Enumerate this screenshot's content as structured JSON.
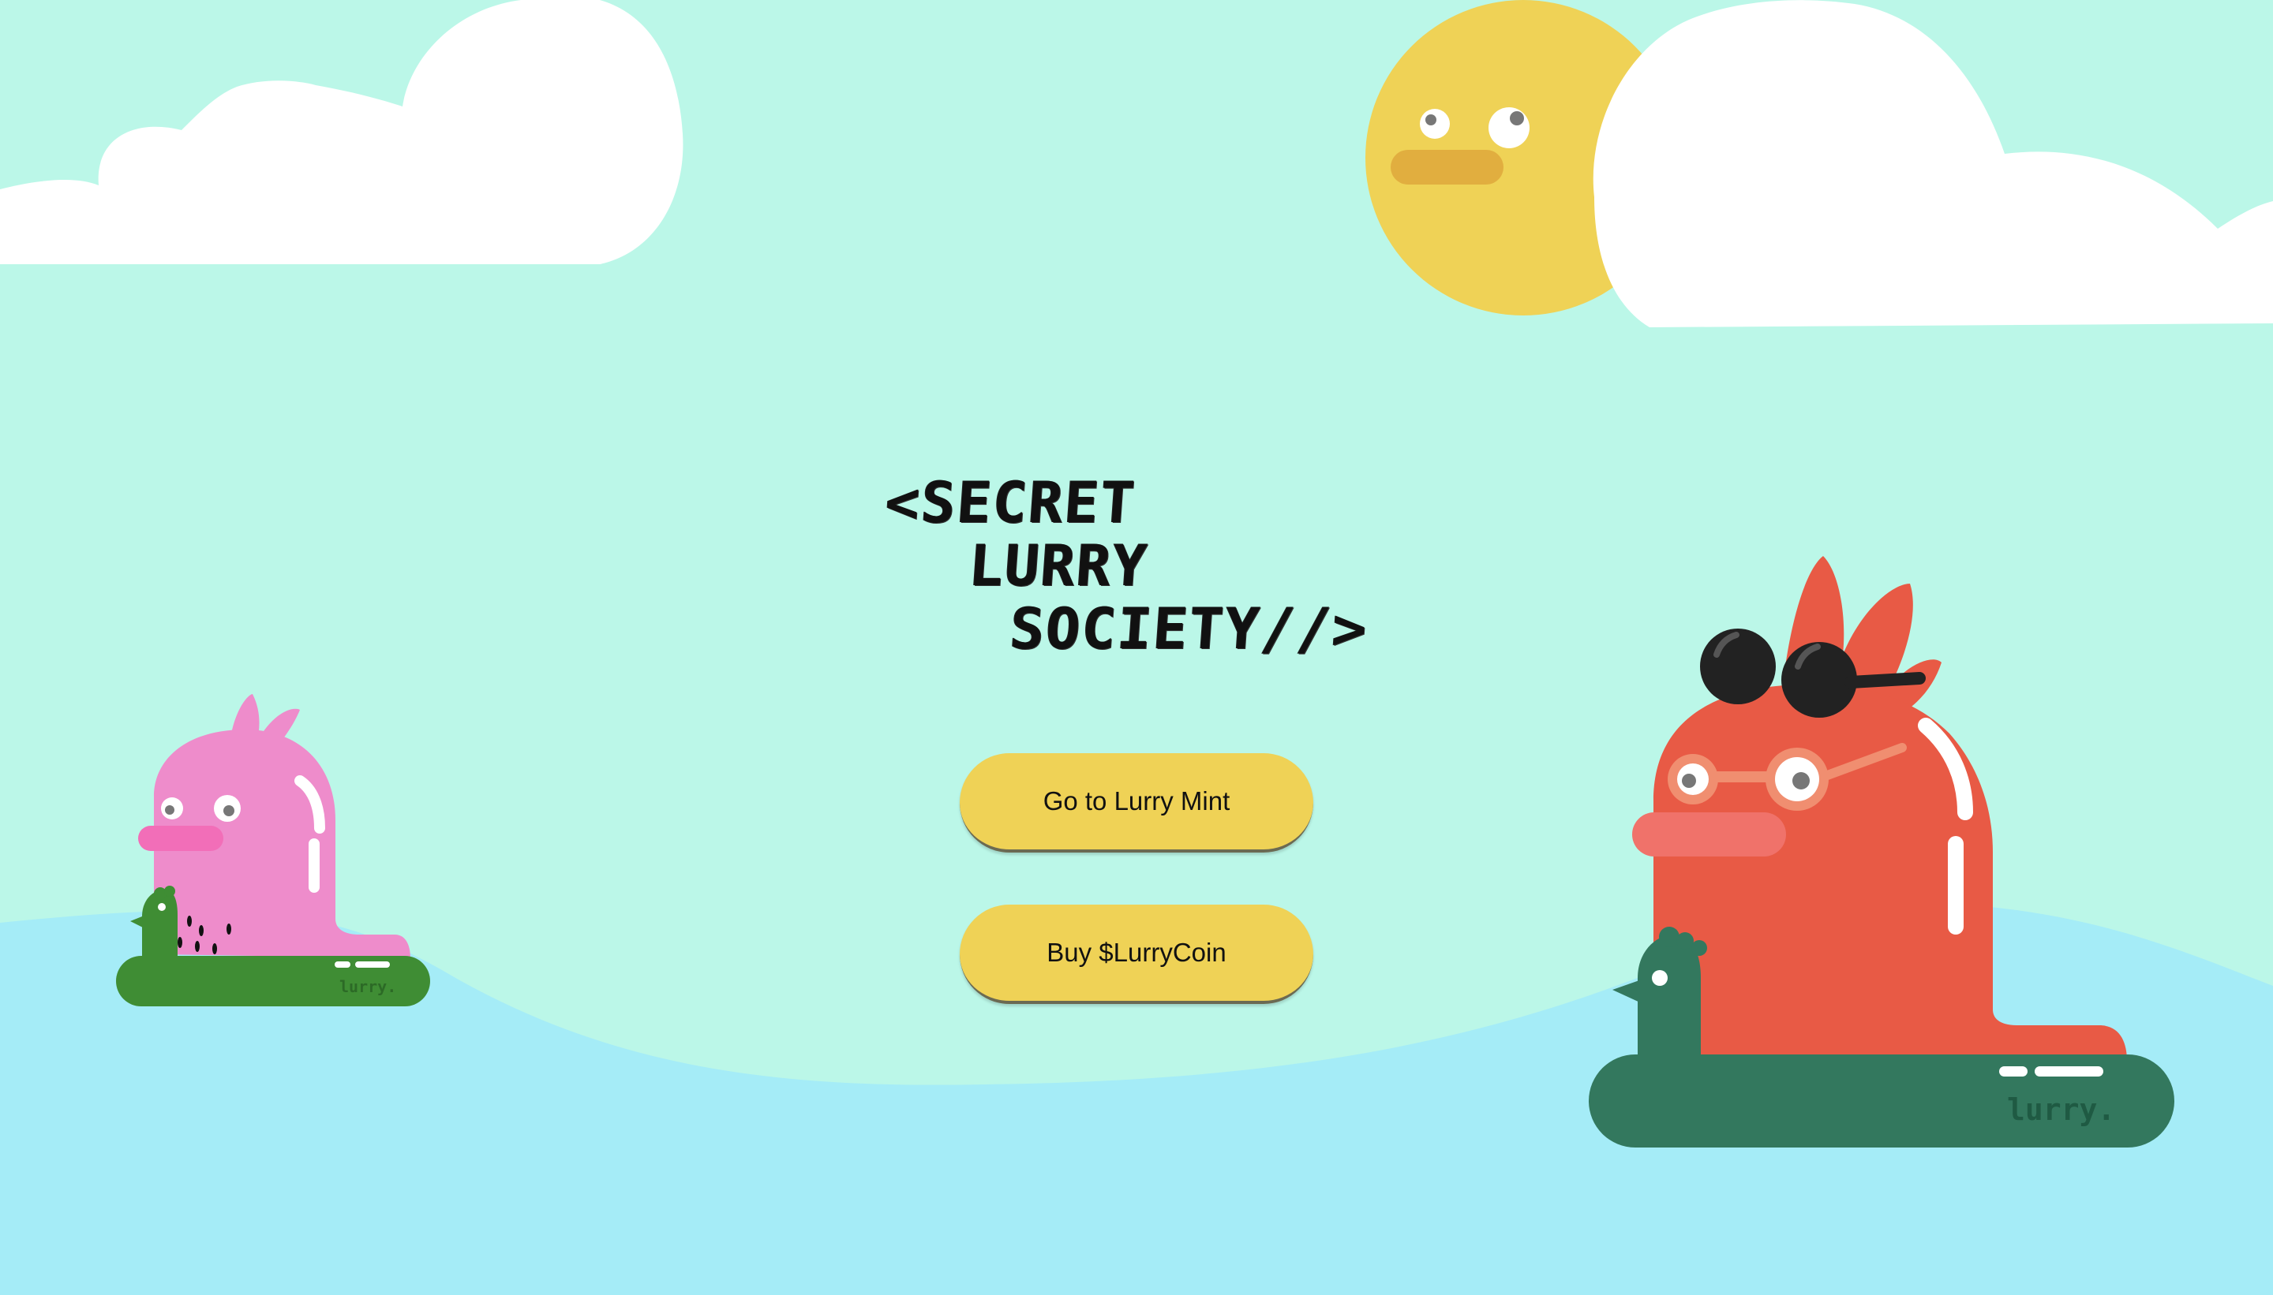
{
  "logo": {
    "line1": "<SECRET",
    "line2": "LURRY",
    "line3": "SOCIETY//>"
  },
  "buttons": {
    "mint_label": "Go to Lurry Mint",
    "coin_label": "Buy $LurryCoin"
  },
  "characters": {
    "float_text": "lurry."
  },
  "colors": {
    "sky": "#bbf7e8",
    "water": "#a5ecf7",
    "sun": "#efd256",
    "button": "#efd256",
    "pink_lurry": "#ee8ccb",
    "red_lurry": "#e85a45",
    "green_float": "#3f8d34",
    "teal_float": "#33785e"
  }
}
